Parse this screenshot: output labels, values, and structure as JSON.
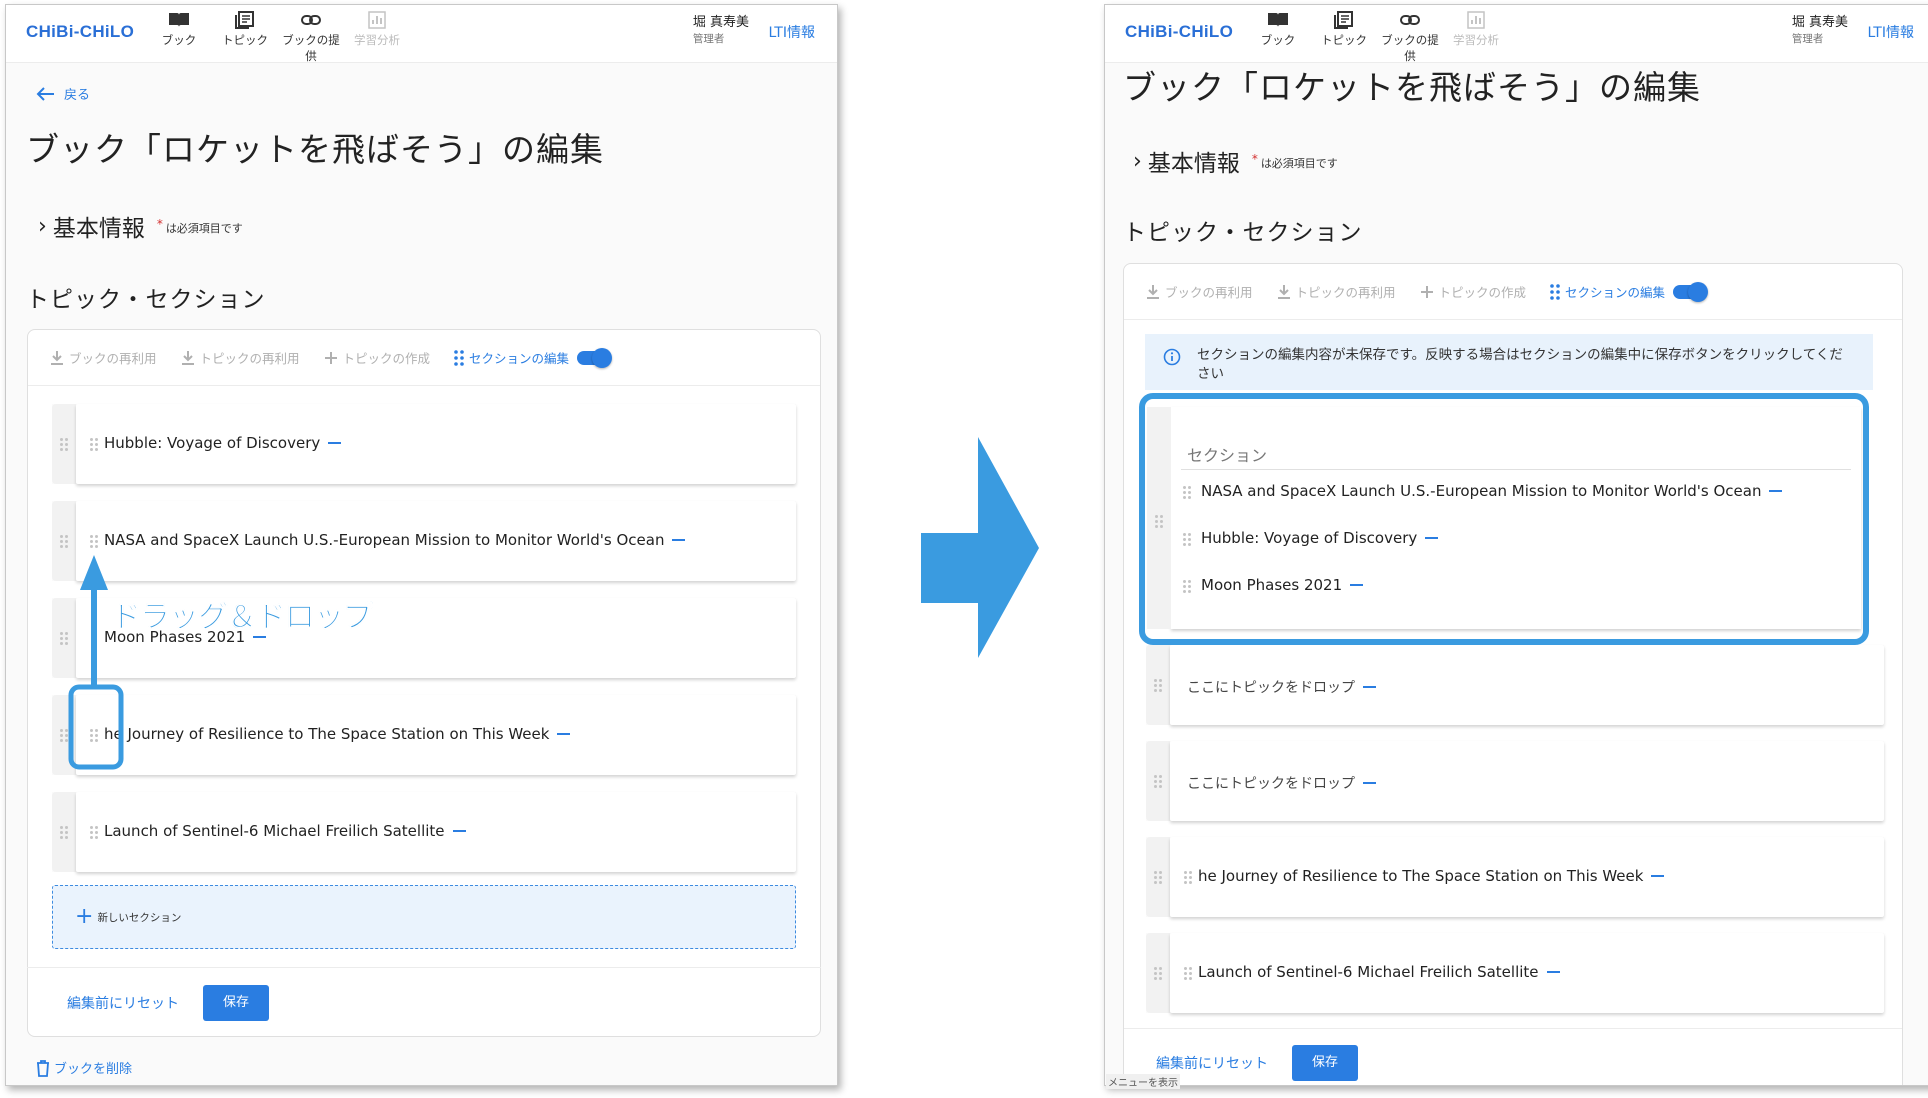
{
  "app": {
    "logo": "CHiBi-CHiLO",
    "nav": [
      {
        "label": "ブック",
        "icon": "book-icon"
      },
      {
        "label": "トピック",
        "icon": "topic-icon"
      },
      {
        "label": "ブックの提供",
        "icon": "link-icon"
      },
      {
        "label": "学習分析",
        "icon": "analytics-icon"
      }
    ],
    "user_name": "堀 真寿美",
    "user_role": "管理者",
    "lti_link": "LTI情報"
  },
  "page": {
    "back_link": "戻る",
    "title": "ブック「ロケットを飛ばそう」の編集",
    "basic_info": "基本情報",
    "required_note": "は必須項目です",
    "required_mark": "*",
    "topic_section_heading": "トピック・セクション",
    "delete_book": "ブックを削除",
    "show_menu": "メニューを表示"
  },
  "toolbar": {
    "reuse_book": "ブックの再利用",
    "reuse_topic": "トピックの再利用",
    "create_topic": "トピックの作成",
    "edit_sections": "セクションの編集"
  },
  "left_topics": [
    "Hubble: Voyage of Discovery",
    "NASA and SpaceX Launch U.S.-European Mission to Monitor World's Ocean",
    "Moon Phases 2021",
    "he Journey of Resilience to The Space Station on This Week",
    "Launch of Sentinel-6 Michael Freilich Satellite"
  ],
  "new_section": "新しいセクション",
  "footer": {
    "reset": "編集前にリセット",
    "save": "保存"
  },
  "annotation": {
    "drag_drop": "ドラッグ＆ドロップ"
  },
  "right": {
    "info_banner": "セクションの編集内容が未保存です。反映する場合はセクションの編集中に保存ボタンをクリックしてください",
    "section_name_placeholder": "セクション",
    "section_topics": [
      "NASA and SpaceX Launch U.S.-European Mission to Monitor World's Ocean",
      "Hubble: Voyage of Discovery",
      "Moon Phases 2021"
    ],
    "drop_placeholder": "ここにトピックをドロップ",
    "rest_topics": [
      "he Journey of Resilience to The Space Station on This Week",
      "Launch of Sentinel-6 Michael Freilich Satellite"
    ]
  },
  "colors": {
    "accent": "#2a7de1",
    "annotation": "#3a9be0"
  }
}
